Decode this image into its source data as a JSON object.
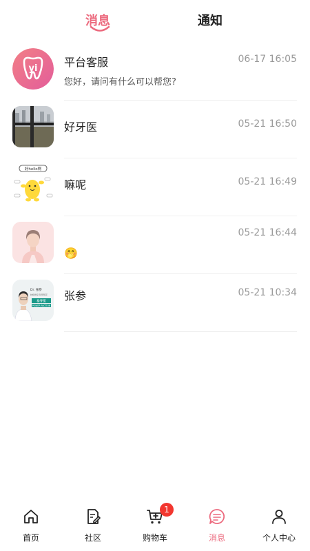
{
  "tabs": {
    "messages": "消息",
    "notifications": "通知"
  },
  "conversations": [
    {
      "name": "平台客服",
      "time": "06-17 16:05",
      "preview": "您好，请问有什么可以帮您?"
    },
    {
      "name": "好牙医",
      "time": "05-21 16:50",
      "preview": ""
    },
    {
      "name": "嘛呢",
      "time": "05-21 16:49",
      "preview": ""
    },
    {
      "name": "",
      "time": "05-21 16:44",
      "preview": "🤭"
    },
    {
      "name": "张参",
      "time": "05-21 10:34",
      "preview": ""
    }
  ],
  "avatar_text": {
    "logo": "yi",
    "sticker": "好hello啊",
    "doctor_name": "Dr. 张参",
    "doctor_subtitle": "种植修复·隐形矫正",
    "doctor_badge": "极牙医",
    "doctor_badge_en": "POWER FACTION"
  },
  "bottom_nav": {
    "items": [
      {
        "label": "首页",
        "icon": "home-icon"
      },
      {
        "label": "社区",
        "icon": "community-edit-icon"
      },
      {
        "label": "购物车",
        "icon": "cart-icon",
        "badge": "1"
      },
      {
        "label": "消息",
        "icon": "message-icon",
        "active": true
      },
      {
        "label": "个人中心",
        "icon": "person-icon"
      }
    ]
  },
  "colors": {
    "accent": "#ec6a7e",
    "badge": "#f2362f",
    "text": "#222222",
    "muted": "#999999"
  }
}
